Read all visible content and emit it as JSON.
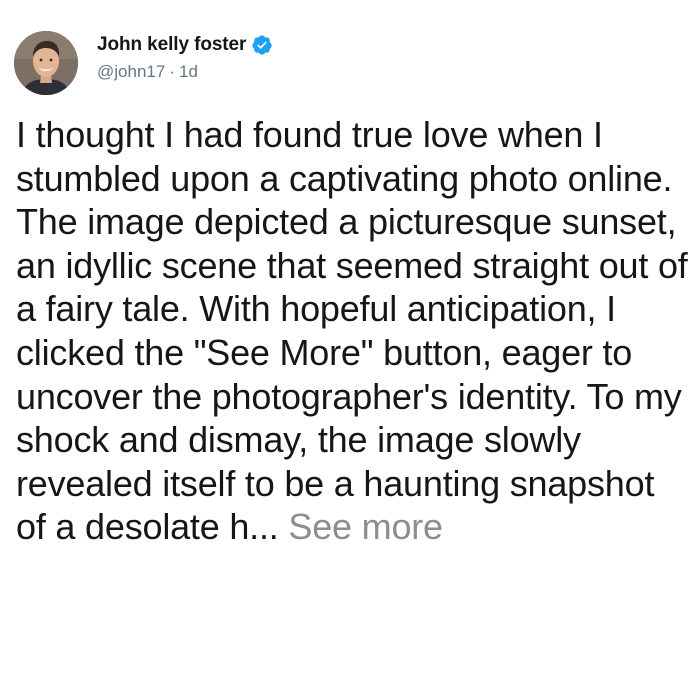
{
  "author": {
    "display_name": "John kelly foster",
    "handle": "@john17",
    "time_ago": "1d",
    "verified": true,
    "verified_color": "#1da1f2"
  },
  "tweet": {
    "text": "I thought I had found true love when I stumbled upon a captivating photo online. The image depicted a picturesque sunset, an idyllic scene that seemed straight out of a fairy tale. With hopeful anticipation, I clicked the \"See More\" button, eager to uncover the photographer's identity. To my shock and dismay, the image slowly revealed itself to be a haunting snapshot of a desolate h...",
    "see_more_label": "See more"
  },
  "icons": {
    "verified": "verified-badge-icon",
    "avatar": "avatar"
  }
}
